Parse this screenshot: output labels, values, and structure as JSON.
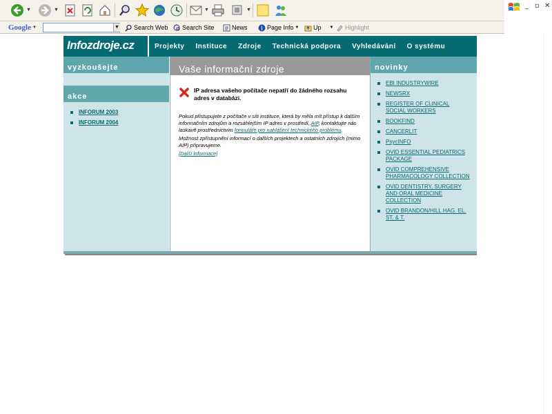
{
  "browser": {
    "toolbar2": {
      "google_label": "Google",
      "search_web": "Search Web",
      "search_site": "Search Site",
      "news": "News",
      "page_info": "Page Info",
      "up": "Up",
      "highlight": "Highlight"
    }
  },
  "site": {
    "logo": "Infozdroje.cz",
    "nav": [
      "Projekty",
      "Instituce",
      "Zdroje",
      "Technická podpora",
      "Vyhledávání",
      "O systému"
    ],
    "left": {
      "head1": "vyzkoušejte",
      "head2": "akce",
      "links": [
        "INFORUM 2003",
        "INFORUM 2004"
      ]
    },
    "center": {
      "title": "Vaše informační zdroje",
      "error": "IP adresa vašeho počítače nepatří do žádného rozsahu adres v databázi.",
      "p1_a": "Pokud přistupujete z počítače v síti instituce, která by měla mít přístup k dalším informačním zdrojům a rozsáhlejším IP adres v prostředí, ",
      "p1_link1": "AIP",
      "p1_b": ", kontaktujte nás laskavě prostřednictvím ",
      "p1_link2": "formuláře pro nahlášení technického problému",
      "p1_c": ".",
      "p2": "Možnost zpřístupnění informací o dalších projektech a ostatních zdrojích (mimo AIP) připravujeme.",
      "more": "[Další informace]"
    },
    "right": {
      "head": "novinky",
      "links": [
        "EBI INDUSTRYWIRE",
        "NEWSRX",
        "REGISTER OF CLINICAL SOCIAL WORKERS",
        "BOOKFIND",
        "CANCERLIT",
        "PsycINFO",
        "OVID ESSENTIAL PEDIATRICS PACKAGE",
        "OVID COMPREHENSIVE PHARMACOLOGY COLLECTION",
        "OVID DENTISTRY, SURGERY AND ORAL MEDICINE COLLECTION",
        "OVID BRANDON/HILL HAG. EL. ST. & T."
      ]
    }
  },
  "colors": {
    "brand": "#066a73",
    "panel": "#cfe4e6",
    "section_head": "#5fa6ad"
  }
}
